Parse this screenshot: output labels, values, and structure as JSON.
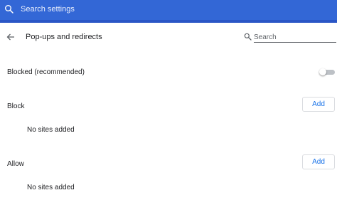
{
  "header": {
    "search_placeholder": "Search settings"
  },
  "page": {
    "title": "Pop-ups and redirects",
    "search_placeholder": "Search"
  },
  "blocked_setting": {
    "label": "Blocked (recommended)",
    "enabled": false
  },
  "block_section": {
    "heading": "Block",
    "add_label": "Add",
    "empty_text": "No sites added"
  },
  "allow_section": {
    "heading": "Allow",
    "add_label": "Add",
    "empty_text": "No sites added"
  },
  "colors": {
    "header": "#3367d6",
    "accent": "#1a73e8",
    "toggle_track_off": "#bdc1c6"
  },
  "icons": {
    "header_search": "search-icon",
    "back": "arrow-back-icon",
    "page_search": "search-icon"
  }
}
